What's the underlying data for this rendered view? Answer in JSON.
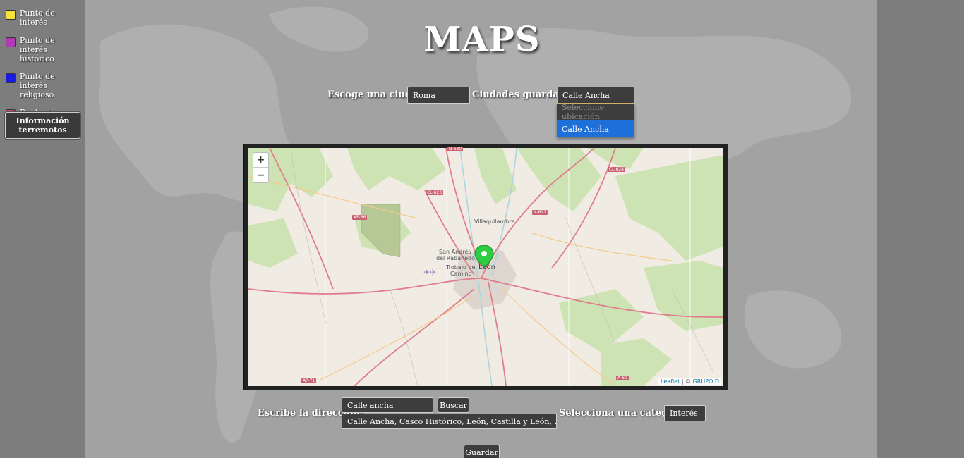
{
  "legend": {
    "items": [
      {
        "label": "Punto de interés",
        "color": "#f3e33a"
      },
      {
        "label": "Punto de interés histórico",
        "color": "#b03ab4"
      },
      {
        "label": "Punto de interés religioso",
        "color": "#1a1ae6"
      },
      {
        "label": "Punto de interés cultural",
        "color": "#c9497a"
      }
    ],
    "earthquake_button": "Información terremotos"
  },
  "header": {
    "title": "MAPS"
  },
  "city": {
    "label": "Escoge una ciudad:",
    "value": "Roma",
    "saved_label": "Ciudades guardadas:",
    "saved_value": "Calle Ancha",
    "saved_options": [
      "Seleccione ubicación",
      "Calle Ancha"
    ]
  },
  "map": {
    "zoom_in": "+",
    "zoom_out": "−",
    "attribution_leaflet": "Leaflet",
    "attribution_sep": " | © ",
    "attribution_rest": "GRUPO D",
    "labels": {
      "villaquilambre": "Villaquilambre",
      "san_andres_1": "San Andrés",
      "san_andres_2": "del Rabanedo",
      "trobajo_1": "Trobajo del",
      "trobajo_2": "Camino",
      "leon": "León"
    },
    "roads": {
      "n630": "N-630",
      "cl623": "CL-623",
      "ap66": "AP-66",
      "n621": "N-621",
      "cl624": "CL-624",
      "ap71": "AP-71",
      "a60": "A-60"
    },
    "marker_color": "#2ecc40"
  },
  "address": {
    "label": "Escribe la dirección:",
    "value": "Calle ancha",
    "search_button": "Buscar",
    "suggestion": "Calle Ancha, Casco Histórico, León, Castilla y León, 2400..."
  },
  "category": {
    "label": "Selecciona una categoría:",
    "value": "Interés"
  },
  "save_button": "Guardar"
}
